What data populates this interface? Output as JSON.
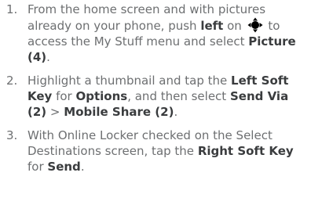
{
  "steps": [
    {
      "number": "1.",
      "parts": [
        {
          "t": "From the home screen and with pictures already on your phone, push "
        },
        {
          "t": "left",
          "b": true
        },
        {
          "t": " on "
        },
        {
          "icon": "directional-pad-icon"
        },
        {
          "t": " to access the My Stuff menu and select "
        },
        {
          "t": "Picture (4)",
          "b": true
        },
        {
          "t": "."
        }
      ]
    },
    {
      "number": "2.",
      "parts": [
        {
          "t": "Highlight a thumbnail and tap the "
        },
        {
          "t": "Left Soft Key",
          "b": true
        },
        {
          "t": " for "
        },
        {
          "t": "Options",
          "b": true
        },
        {
          "t": ", and then select "
        },
        {
          "t": "Send Via (2)",
          "b": true
        },
        {
          "t": " > "
        },
        {
          "t": "Mobile Share (2)",
          "b": true
        },
        {
          "t": "."
        }
      ]
    },
    {
      "number": "3.",
      "parts": [
        {
          "t": "With Online Locker checked on the Select Destinations screen, tap the "
        },
        {
          "t": "Right Soft Key",
          "b": true
        },
        {
          "t": " for "
        },
        {
          "t": "Send",
          "b": true
        },
        {
          "t": "."
        }
      ]
    }
  ]
}
